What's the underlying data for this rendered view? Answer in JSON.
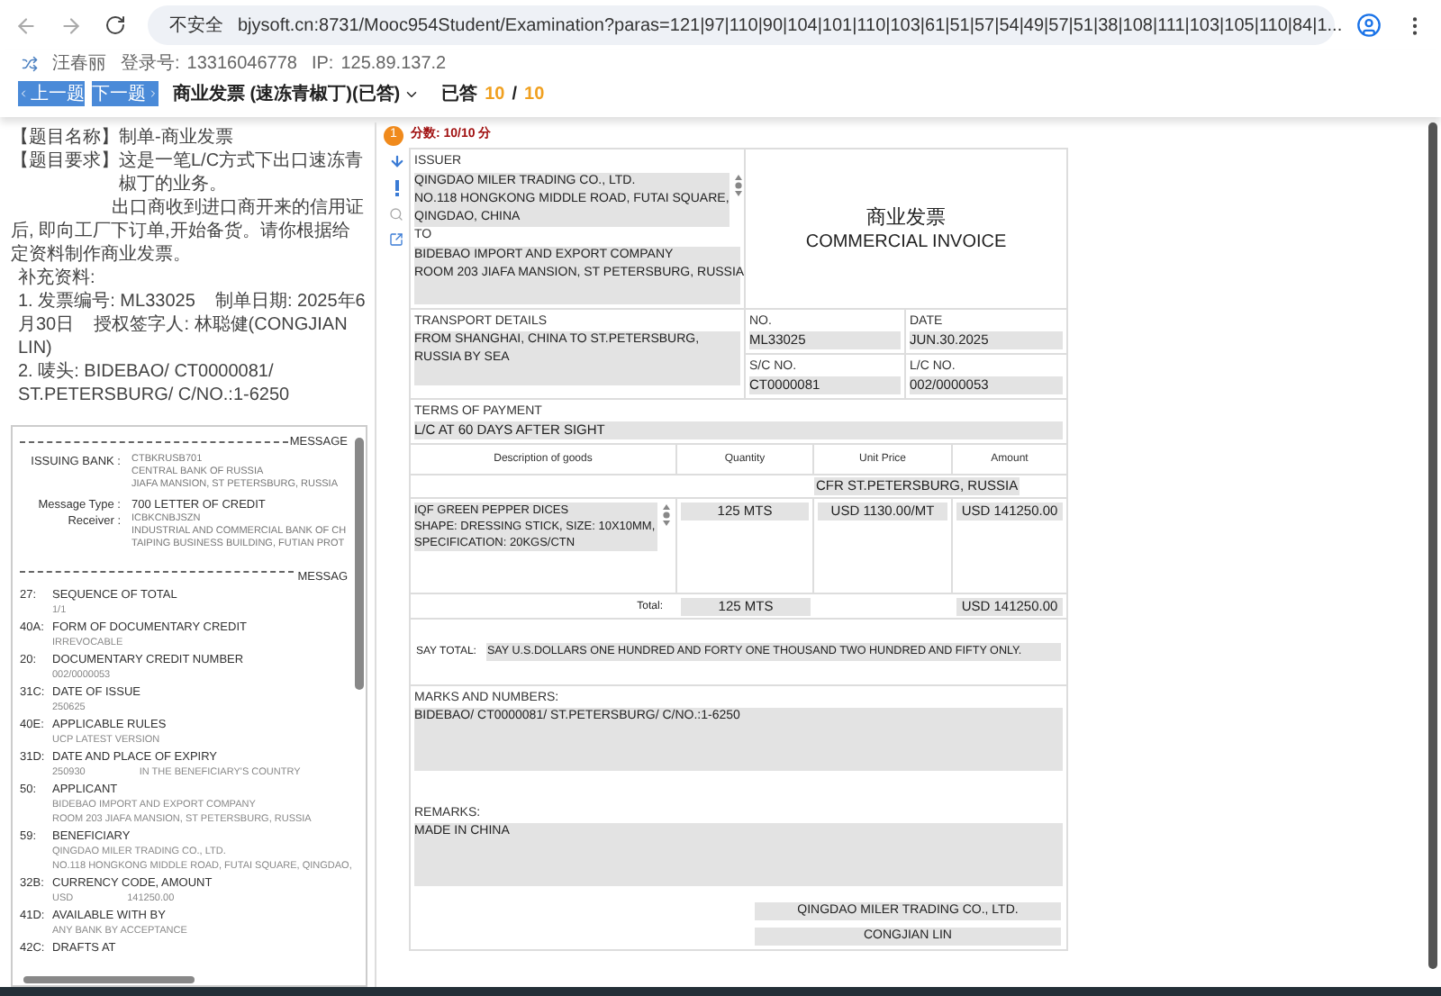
{
  "browser": {
    "security": "不安全",
    "url": "bjysoft.cn:8731/Mooc954Student/Examination?paras=121|97|110|90|104|101|110|103|61|51|57|54|49|57|51|38|108|111|103|105|110|84|1..."
  },
  "header": {
    "user": "汪春丽",
    "login_label": "登录号:",
    "login": "13316046778",
    "ip_label": "IP:",
    "ip": "125.89.137.2"
  },
  "nav": {
    "prev": "上一题",
    "next": "下一题",
    "question": "商业发票 (速冻青椒丁)(已答)",
    "answered_label": "已答",
    "answered": "10",
    "separator": "/",
    "total": "10"
  },
  "question": {
    "name_label": "【题目名称】",
    "name": "制单-商业发票",
    "req_label": "【题目要求】",
    "req_1": "这是一笔L/C方式下出口速冻青椒丁的业务。",
    "req_2": "出口商收到进口商开来的信用证后, 即向工厂下订单,开始备货。请你根据给定资料制作商业发票。",
    "supp_title": "补充资料:",
    "supp": [
      "1. 发票编号: ML33025    制单日期: 2025年6月30日    授权签字人: 林聪健(CONGJIAN LIN)",
      "2. 唛头: BIDEBAO/ CT0000081/ ST.PETERSBURG/ C/NO.:1-6250"
    ]
  },
  "message": {
    "header_1": "MESSAGE",
    "issuing_label": "ISSUING BANK :",
    "issuing": [
      "CTBKRUSB701",
      "CENTRAL BANK OF RUSSIA",
      "JIAFA MANSION, ST PETERSBURG, RUSSIA"
    ],
    "type_label": "Message Type :",
    "type": "700 LETTER OF CREDIT",
    "receiver_label": "Receiver :",
    "receiver": [
      "ICBKCNBJSZN",
      "INDUSTRIAL AND COMMERCIAL BANK OF CH",
      "TAIPING BUSINESS BUILDING, FUTIAN PROT"
    ],
    "header_2": "MESSAG",
    "fields": [
      {
        "tag": "27:",
        "title": "SEQUENCE OF TOTAL",
        "values": [
          [
            "1/1"
          ]
        ]
      },
      {
        "tag": "40A:",
        "title": "FORM OF DOCUMENTARY CREDIT",
        "values": [
          [
            "IRREVOCABLE"
          ]
        ]
      },
      {
        "tag": "20:",
        "title": "DOCUMENTARY CREDIT NUMBER",
        "values": [
          [
            "002/0000053"
          ]
        ]
      },
      {
        "tag": "31C:",
        "title": "DATE OF ISSUE",
        "values": [
          [
            "250625"
          ]
        ]
      },
      {
        "tag": "40E:",
        "title": "APPLICABLE RULES",
        "values": [
          [
            "UCP LATEST VERSION"
          ]
        ]
      },
      {
        "tag": "31D:",
        "title": "DATE AND PLACE OF EXPIRY",
        "values": [
          [
            "250930",
            "IN THE BENEFICIARY'S COUNTRY"
          ]
        ]
      },
      {
        "tag": "50:",
        "title": "APPLICANT",
        "values": [
          [
            "BIDEBAO IMPORT AND EXPORT COMPANY"
          ],
          [
            "ROOM 203 JIAFA MANSION, ST PETERSBURG, RUSSIA"
          ]
        ]
      },
      {
        "tag": "59:",
        "title": "BENEFICIARY",
        "values": [
          [
            "QINGDAO MILER TRADING CO., LTD."
          ],
          [
            "NO.118 HONGKONG MIDDLE ROAD, FUTAI SQUARE, QINGDAO,"
          ]
        ]
      },
      {
        "tag": "32B:",
        "title": "CURRENCY CODE, AMOUNT",
        "values": [
          [
            "USD",
            "141250.00"
          ]
        ]
      },
      {
        "tag": "41D:",
        "title": "AVAILABLE WITH BY",
        "values": [
          [
            "ANY BANK BY ACCEPTANCE"
          ]
        ]
      },
      {
        "tag": "42C:",
        "title": "DRAFTS AT"
      }
    ]
  },
  "answer": {
    "number": "1",
    "score": "分数: 10/10 分",
    "issuer_label": "ISSUER",
    "issuer": [
      "QINGDAO MILER TRADING CO., LTD.",
      "NO.118 HONGKONG MIDDLE ROAD, FUTAI SQUARE,",
      "QINGDAO, CHINA"
    ],
    "to_label": "TO",
    "to": [
      "BIDEBAO IMPORT AND EXPORT COMPANY",
      "ROOM 203 JIAFA MANSION, ST PETERSBURG, RUSSIA"
    ],
    "title_cn": "商业发票",
    "title_en": "COMMERCIAL INVOICE",
    "transport_label": "TRANSPORT DETAILS",
    "transport": "FROM SHANGHAI, CHINA TO ST.PETERSBURG, RUSSIA BY SEA",
    "no_label": "NO.",
    "no": "ML33025",
    "date_label": "DATE",
    "date": "JUN.30.2025",
    "sc_label": "S/C NO.",
    "sc": "CT0000081",
    "lc_label": "L/C NO.",
    "lc": "002/0000053",
    "terms_label": "TERMS OF PAYMENT",
    "terms": "L/C AT 60 DAYS AFTER SIGHT",
    "columns": [
      "Description of goods",
      "Quantity",
      "Unit Price",
      "Amount"
    ],
    "price_term": "CFR ST.PETERSBURG, RUSSIA",
    "goods": [
      "IQF GREEN PEPPER DICES",
      "SHAPE: DRESSING STICK, SIZE: 10X10MM,",
      "SPECIFICATION: 20KGS/CTN"
    ],
    "quantity": "125 MTS",
    "unit_price": "USD 1130.00/MT",
    "amount": "USD 141250.00",
    "total_label": "Total:",
    "total_quantity": "125 MTS",
    "total_amount": "USD 141250.00",
    "say_label": "SAY TOTAL:",
    "say": "SAY U.S.DOLLARS ONE HUNDRED AND FORTY ONE THOUSAND TWO HUNDRED AND FIFTY ONLY.",
    "marks_label": "MARKS AND NUMBERS:",
    "marks": "BIDEBAO/ CT0000081/ ST.PETERSBURG/ C/NO.:1-6250",
    "remarks_label": "REMARKS:",
    "remarks": "MADE IN CHINA",
    "signer_company": "QINGDAO MILER TRADING CO., LTD.",
    "signer": "CONGJIAN LIN"
  }
}
